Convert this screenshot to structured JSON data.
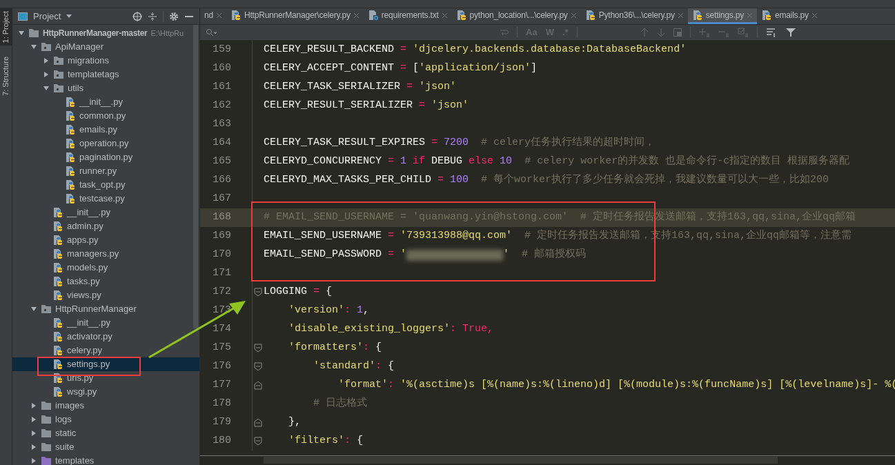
{
  "side_strip": [
    {
      "label": "1: Project",
      "selected": true
    },
    {
      "label": "7: Structure",
      "selected": false
    }
  ],
  "project_panel": {
    "title": "Project",
    "tree": [
      {
        "label": "HttpRunnerManager-master",
        "hint": "E:\\HttpRu",
        "kind": "root",
        "expanded": true,
        "selected": false,
        "children": [
          {
            "label": "ApiManager",
            "kind": "module",
            "expanded": true,
            "selected": false,
            "children": [
              {
                "label": "migrations",
                "kind": "module",
                "expanded": false,
                "selected": false
              },
              {
                "label": "templatetags",
                "kind": "module",
                "expanded": false,
                "selected": false
              },
              {
                "label": "utils",
                "kind": "module",
                "expanded": true,
                "selected": false,
                "children": [
                  {
                    "label": "__init__.py",
                    "kind": "python",
                    "selected": false
                  },
                  {
                    "label": "common.py",
                    "kind": "python",
                    "selected": false
                  },
                  {
                    "label": "emails.py",
                    "kind": "python",
                    "selected": false
                  },
                  {
                    "label": "operation.py",
                    "kind": "python",
                    "selected": false
                  },
                  {
                    "label": "pagination.py",
                    "kind": "python",
                    "selected": false
                  },
                  {
                    "label": "runner.py",
                    "kind": "python",
                    "selected": false
                  },
                  {
                    "label": "task_opt.py",
                    "kind": "python",
                    "selected": false
                  },
                  {
                    "label": "testcase.py",
                    "kind": "python",
                    "selected": false
                  }
                ]
              },
              {
                "label": "__init__.py",
                "kind": "python",
                "selected": false
              },
              {
                "label": "admin.py",
                "kind": "python",
                "selected": false
              },
              {
                "label": "apps.py",
                "kind": "python",
                "selected": false
              },
              {
                "label": "managers.py",
                "kind": "python",
                "selected": false
              },
              {
                "label": "models.py",
                "kind": "python",
                "selected": false
              },
              {
                "label": "tasks.py",
                "kind": "python",
                "selected": false
              },
              {
                "label": "views.py",
                "kind": "python",
                "selected": false
              }
            ]
          },
          {
            "label": "HttpRunnerManager",
            "kind": "module",
            "expanded": true,
            "selected": false,
            "children": [
              {
                "label": "__init__.py",
                "kind": "python",
                "selected": false
              },
              {
                "label": "activator.py",
                "kind": "python",
                "selected": false
              },
              {
                "label": "celery.py",
                "kind": "python",
                "selected": false
              },
              {
                "label": "settings.py",
                "kind": "python",
                "selected": true
              },
              {
                "label": "urls.py",
                "kind": "python",
                "selected": false
              },
              {
                "label": "wsgi.py",
                "kind": "python",
                "selected": false
              }
            ]
          },
          {
            "label": "images",
            "kind": "folder",
            "expanded": false,
            "selected": false
          },
          {
            "label": "logs",
            "kind": "folder",
            "expanded": false,
            "selected": false
          },
          {
            "label": "static",
            "kind": "folder",
            "expanded": false,
            "selected": false
          },
          {
            "label": "suite",
            "kind": "folder",
            "expanded": false,
            "selected": false
          },
          {
            "label": "templates",
            "kind": "templates",
            "expanded": false,
            "selected": false
          }
        ]
      }
    ]
  },
  "tabs": [
    {
      "label": "nd",
      "kind": "none",
      "selected": false
    },
    {
      "label": "HttpRunnerManager\\celery.py",
      "kind": "python",
      "selected": false
    },
    {
      "label": "requirements.txt",
      "kind": "text",
      "selected": false
    },
    {
      "label": "python_location\\...\\celery.py",
      "kind": "python",
      "selected": false
    },
    {
      "label": "Python36\\...\\celery.py",
      "kind": "python",
      "selected": false
    },
    {
      "label": "settings.py",
      "kind": "python",
      "selected": true
    },
    {
      "label": "emails.py",
      "kind": "python",
      "selected": false
    }
  ],
  "find_bar": {
    "options": [
      "Aa",
      "W",
      ".*"
    ]
  },
  "code": [
    {
      "number": "159",
      "highlighted": false,
      "tokens": [
        {
          "kind": "id",
          "text": "CELERY_RESULT_BACKEND "
        },
        {
          "kind": "op",
          "text": "="
        },
        {
          "kind": "str",
          "text": " 'djcelery.backends.database:DatabaseBackend'"
        }
      ]
    },
    {
      "number": "160",
      "highlighted": false,
      "tokens": [
        {
          "kind": "id",
          "text": "CELERY_ACCEPT_CONTENT "
        },
        {
          "kind": "op",
          "text": "="
        },
        {
          "kind": "id",
          "text": " ["
        },
        {
          "kind": "str",
          "text": "'application/json'"
        },
        {
          "kind": "id",
          "text": "]"
        }
      ]
    },
    {
      "number": "161",
      "highlighted": false,
      "tokens": [
        {
          "kind": "id",
          "text": "CELERY_TASK_SERIALIZER "
        },
        {
          "kind": "op",
          "text": "="
        },
        {
          "kind": "str",
          "text": " 'json'"
        }
      ]
    },
    {
      "number": "162",
      "highlighted": false,
      "tokens": [
        {
          "kind": "id",
          "text": "CELERY_RESULT_SERIALIZER "
        },
        {
          "kind": "op",
          "text": "="
        },
        {
          "kind": "str",
          "text": " 'json'"
        }
      ]
    },
    {
      "number": "163",
      "highlighted": false
    },
    {
      "number": "164",
      "highlighted": false,
      "tokens": [
        {
          "kind": "id",
          "text": "CELERY_TASK_RESULT_EXPIRES "
        },
        {
          "kind": "op",
          "text": "="
        },
        {
          "kind": "num",
          "text": " 7200"
        },
        {
          "kind": "comment",
          "text": "  # celery任务执行结果的超时时间，"
        }
      ]
    },
    {
      "number": "165",
      "highlighted": false,
      "tokens": [
        {
          "kind": "id",
          "text": "CELERYD_CONCURRENCY "
        },
        {
          "kind": "op",
          "text": "="
        },
        {
          "kind": "num",
          "text": " 1 "
        },
        {
          "kind": "kw",
          "text": "if"
        },
        {
          "kind": "id",
          "text": " DEBUG "
        },
        {
          "kind": "kw",
          "text": "else"
        },
        {
          "kind": "num",
          "text": " 10"
        },
        {
          "kind": "comment",
          "text": "  # celery worker的并发数 也是命令行-c指定的数目 根据服务器配"
        }
      ]
    },
    {
      "number": "166",
      "highlighted": false,
      "tokens": [
        {
          "kind": "id",
          "text": "CELERYD_MAX_TASKS_PER_CHILD "
        },
        {
          "kind": "op",
          "text": "="
        },
        {
          "kind": "num",
          "text": " 100"
        },
        {
          "kind": "comment",
          "text": "  # 每个worker执行了多少任务就会死掉，我建议数量可以大一些，比如200"
        }
      ]
    },
    {
      "number": "167",
      "highlighted": false
    },
    {
      "number": "168",
      "highlighted": true,
      "tokens": [
        {
          "kind": "comment",
          "text": "# EMAIL_SEND_USERNAME = 'quanwang.yin@hstong.com'  # 定时任务报告发送邮箱，支持163,qq,sina,企业qq邮箱"
        }
      ]
    },
    {
      "number": "169",
      "highlighted": false,
      "tokens": [
        {
          "kind": "id",
          "text": "EMAIL_SEND_USERNAME "
        },
        {
          "kind": "op",
          "text": "="
        },
        {
          "kind": "str",
          "text": " '739313988@qq.com'"
        },
        {
          "kind": "comment",
          "text": "  # 定时任务报告发送邮箱，支持163,qq,sina,企业qq邮箱等，注意需"
        }
      ]
    },
    {
      "number": "170",
      "highlighted": false,
      "tokens": [
        {
          "kind": "id",
          "text": "EMAIL_SEND_PASSWORD "
        },
        {
          "kind": "op",
          "text": "="
        },
        {
          "kind": "str",
          "text": " '"
        },
        {
          "kind": "redacted"
        },
        {
          "kind": "str",
          "text": "'"
        },
        {
          "kind": "comment",
          "text": "  # 邮箱授权码"
        }
      ]
    },
    {
      "number": "171",
      "highlighted": false
    },
    {
      "number": "172",
      "highlighted": false,
      "kind": "fold-open",
      "tokens": [
        {
          "kind": "id",
          "text": "LOGGING "
        },
        {
          "kind": "op",
          "text": "="
        },
        {
          "kind": "id",
          "text": " {"
        }
      ]
    },
    {
      "number": "173",
      "highlighted": false,
      "tokens": [
        {
          "kind": "str",
          "text": "    'version'"
        },
        {
          "kind": "op",
          "text": ":"
        },
        {
          "kind": "num",
          "text": " 1"
        },
        {
          "kind": "id",
          "text": ","
        }
      ]
    },
    {
      "number": "174",
      "highlighted": false,
      "tokens": [
        {
          "kind": "str",
          "text": "    'disable_existing_loggers'"
        },
        {
          "kind": "op",
          "text": ":"
        },
        {
          "kind": "kw",
          "text": " True,"
        }
      ]
    },
    {
      "number": "175",
      "highlighted": false,
      "kind": "fold-open",
      "tokens": [
        {
          "kind": "str",
          "text": "    'formatters'"
        },
        {
          "kind": "op",
          "text": ":"
        },
        {
          "kind": "id",
          "text": " {"
        }
      ]
    },
    {
      "number": "176",
      "highlighted": false,
      "kind": "fold-open",
      "tokens": [
        {
          "kind": "str",
          "text": "        'standard'"
        },
        {
          "kind": "op",
          "text": ":"
        },
        {
          "kind": "id",
          "text": " {"
        }
      ]
    },
    {
      "number": "177",
      "highlighted": false,
      "kind": "fold-close",
      "tokens": [
        {
          "kind": "str",
          "text": "            'format'"
        },
        {
          "kind": "op",
          "text": ":"
        },
        {
          "kind": "str",
          "text": " '%(asctime)s [%(name)s:%(lineno)d] [%(module)s:%(funcName)s] [%(levelname)s]- %("
        }
      ]
    },
    {
      "number": "178",
      "highlighted": false,
      "tokens": [
        {
          "kind": "comment",
          "text": "        # 日志格式"
        }
      ]
    },
    {
      "number": "179",
      "highlighted": false,
      "kind": "fold-close",
      "tokens": [
        {
          "kind": "id",
          "text": "    },"
        }
      ]
    },
    {
      "number": "180",
      "highlighted": false,
      "kind": "fold-open",
      "tokens": [
        {
          "kind": "str",
          "text": "    'filters'"
        },
        {
          "kind": "op",
          "text": ":"
        },
        {
          "kind": "id",
          "text": " {"
        }
      ]
    }
  ]
}
